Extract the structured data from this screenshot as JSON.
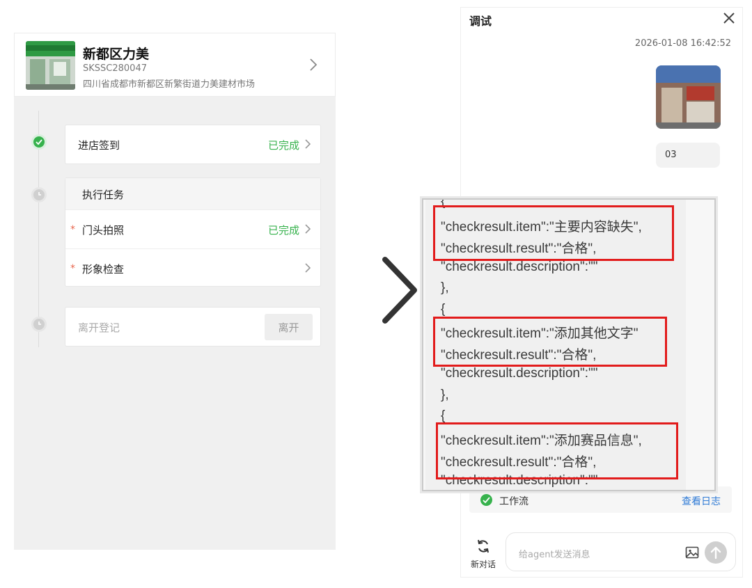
{
  "left_panel": {
    "store": {
      "name": "新都区力美",
      "code": "SKSSC280047",
      "address": "四川省成都市新都区新繁街道力美建材市场"
    },
    "checkin": {
      "label": "进店签到",
      "status": "已完成"
    },
    "tasks": {
      "header": "执行任务",
      "items": [
        {
          "required": "*",
          "label": "门头拍照",
          "status": "已完成"
        },
        {
          "required": "*",
          "label": "形象检查",
          "status": ""
        }
      ]
    },
    "leave": {
      "placeholder": "离开登记",
      "button": "离开"
    }
  },
  "right_panel": {
    "title": "调试",
    "timestamp": "2026-01-08 16:42:52",
    "message_text": "03",
    "workflow": {
      "label": "工作流",
      "link": "查看日志"
    },
    "new_chat_label": "新对话",
    "input_placeholder": "给agent发送消息"
  },
  "json_result": {
    "lines": [
      "{",
      "\"checkresult.item\":\"主要内容缺失\",",
      "\"checkresult.result\":\"合格\",",
      "\"checkresult.description\":\"\"",
      "},",
      "{",
      "\"checkresult.item\":\"添加其他文字\"",
      "\"checkresult.result\":\"合格\",",
      "\"checkresult.description\":\"\"",
      "},",
      "{",
      "\"checkresult.item\":\"添加赛品信息\",",
      "\"checkresult.result\":\"合格\",",
      "\"checkresult.description\":\"\""
    ]
  },
  "colors": {
    "accent_green": "#37b24d",
    "highlight_red": "#e21b1b",
    "link_blue": "#2f7bd6"
  },
  "icons": [
    "chevron-right-icon",
    "check-circle-icon",
    "clock-icon",
    "close-icon",
    "refresh-icon",
    "image-icon",
    "send-arrow-icon"
  ]
}
